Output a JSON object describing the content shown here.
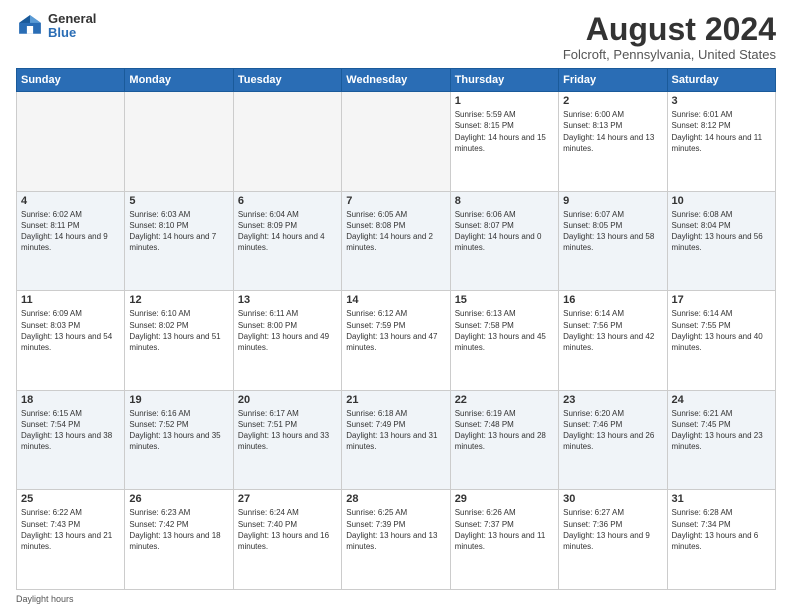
{
  "header": {
    "logo_general": "General",
    "logo_blue": "Blue",
    "month_title": "August 2024",
    "location": "Folcroft, Pennsylvania, United States"
  },
  "weekdays": [
    "Sunday",
    "Monday",
    "Tuesday",
    "Wednesday",
    "Thursday",
    "Friday",
    "Saturday"
  ],
  "footer": {
    "note": "Daylight hours"
  },
  "weeks": [
    [
      {
        "day": "",
        "empty": true
      },
      {
        "day": "",
        "empty": true
      },
      {
        "day": "",
        "empty": true
      },
      {
        "day": "",
        "empty": true
      },
      {
        "day": "1",
        "sunrise": "5:59 AM",
        "sunset": "8:15 PM",
        "daylight": "14 hours and 15 minutes."
      },
      {
        "day": "2",
        "sunrise": "6:00 AM",
        "sunset": "8:13 PM",
        "daylight": "14 hours and 13 minutes."
      },
      {
        "day": "3",
        "sunrise": "6:01 AM",
        "sunset": "8:12 PM",
        "daylight": "14 hours and 11 minutes."
      }
    ],
    [
      {
        "day": "4",
        "sunrise": "6:02 AM",
        "sunset": "8:11 PM",
        "daylight": "14 hours and 9 minutes."
      },
      {
        "day": "5",
        "sunrise": "6:03 AM",
        "sunset": "8:10 PM",
        "daylight": "14 hours and 7 minutes."
      },
      {
        "day": "6",
        "sunrise": "6:04 AM",
        "sunset": "8:09 PM",
        "daylight": "14 hours and 4 minutes."
      },
      {
        "day": "7",
        "sunrise": "6:05 AM",
        "sunset": "8:08 PM",
        "daylight": "14 hours and 2 minutes."
      },
      {
        "day": "8",
        "sunrise": "6:06 AM",
        "sunset": "8:07 PM",
        "daylight": "14 hours and 0 minutes."
      },
      {
        "day": "9",
        "sunrise": "6:07 AM",
        "sunset": "8:05 PM",
        "daylight": "13 hours and 58 minutes."
      },
      {
        "day": "10",
        "sunrise": "6:08 AM",
        "sunset": "8:04 PM",
        "daylight": "13 hours and 56 minutes."
      }
    ],
    [
      {
        "day": "11",
        "sunrise": "6:09 AM",
        "sunset": "8:03 PM",
        "daylight": "13 hours and 54 minutes."
      },
      {
        "day": "12",
        "sunrise": "6:10 AM",
        "sunset": "8:02 PM",
        "daylight": "13 hours and 51 minutes."
      },
      {
        "day": "13",
        "sunrise": "6:11 AM",
        "sunset": "8:00 PM",
        "daylight": "13 hours and 49 minutes."
      },
      {
        "day": "14",
        "sunrise": "6:12 AM",
        "sunset": "7:59 PM",
        "daylight": "13 hours and 47 minutes."
      },
      {
        "day": "15",
        "sunrise": "6:13 AM",
        "sunset": "7:58 PM",
        "daylight": "13 hours and 45 minutes."
      },
      {
        "day": "16",
        "sunrise": "6:14 AM",
        "sunset": "7:56 PM",
        "daylight": "13 hours and 42 minutes."
      },
      {
        "day": "17",
        "sunrise": "6:14 AM",
        "sunset": "7:55 PM",
        "daylight": "13 hours and 40 minutes."
      }
    ],
    [
      {
        "day": "18",
        "sunrise": "6:15 AM",
        "sunset": "7:54 PM",
        "daylight": "13 hours and 38 minutes."
      },
      {
        "day": "19",
        "sunrise": "6:16 AM",
        "sunset": "7:52 PM",
        "daylight": "13 hours and 35 minutes."
      },
      {
        "day": "20",
        "sunrise": "6:17 AM",
        "sunset": "7:51 PM",
        "daylight": "13 hours and 33 minutes."
      },
      {
        "day": "21",
        "sunrise": "6:18 AM",
        "sunset": "7:49 PM",
        "daylight": "13 hours and 31 minutes."
      },
      {
        "day": "22",
        "sunrise": "6:19 AM",
        "sunset": "7:48 PM",
        "daylight": "13 hours and 28 minutes."
      },
      {
        "day": "23",
        "sunrise": "6:20 AM",
        "sunset": "7:46 PM",
        "daylight": "13 hours and 26 minutes."
      },
      {
        "day": "24",
        "sunrise": "6:21 AM",
        "sunset": "7:45 PM",
        "daylight": "13 hours and 23 minutes."
      }
    ],
    [
      {
        "day": "25",
        "sunrise": "6:22 AM",
        "sunset": "7:43 PM",
        "daylight": "13 hours and 21 minutes."
      },
      {
        "day": "26",
        "sunrise": "6:23 AM",
        "sunset": "7:42 PM",
        "daylight": "13 hours and 18 minutes."
      },
      {
        "day": "27",
        "sunrise": "6:24 AM",
        "sunset": "7:40 PM",
        "daylight": "13 hours and 16 minutes."
      },
      {
        "day": "28",
        "sunrise": "6:25 AM",
        "sunset": "7:39 PM",
        "daylight": "13 hours and 13 minutes."
      },
      {
        "day": "29",
        "sunrise": "6:26 AM",
        "sunset": "7:37 PM",
        "daylight": "13 hours and 11 minutes."
      },
      {
        "day": "30",
        "sunrise": "6:27 AM",
        "sunset": "7:36 PM",
        "daylight": "13 hours and 9 minutes."
      },
      {
        "day": "31",
        "sunrise": "6:28 AM",
        "sunset": "7:34 PM",
        "daylight": "13 hours and 6 minutes."
      }
    ]
  ]
}
